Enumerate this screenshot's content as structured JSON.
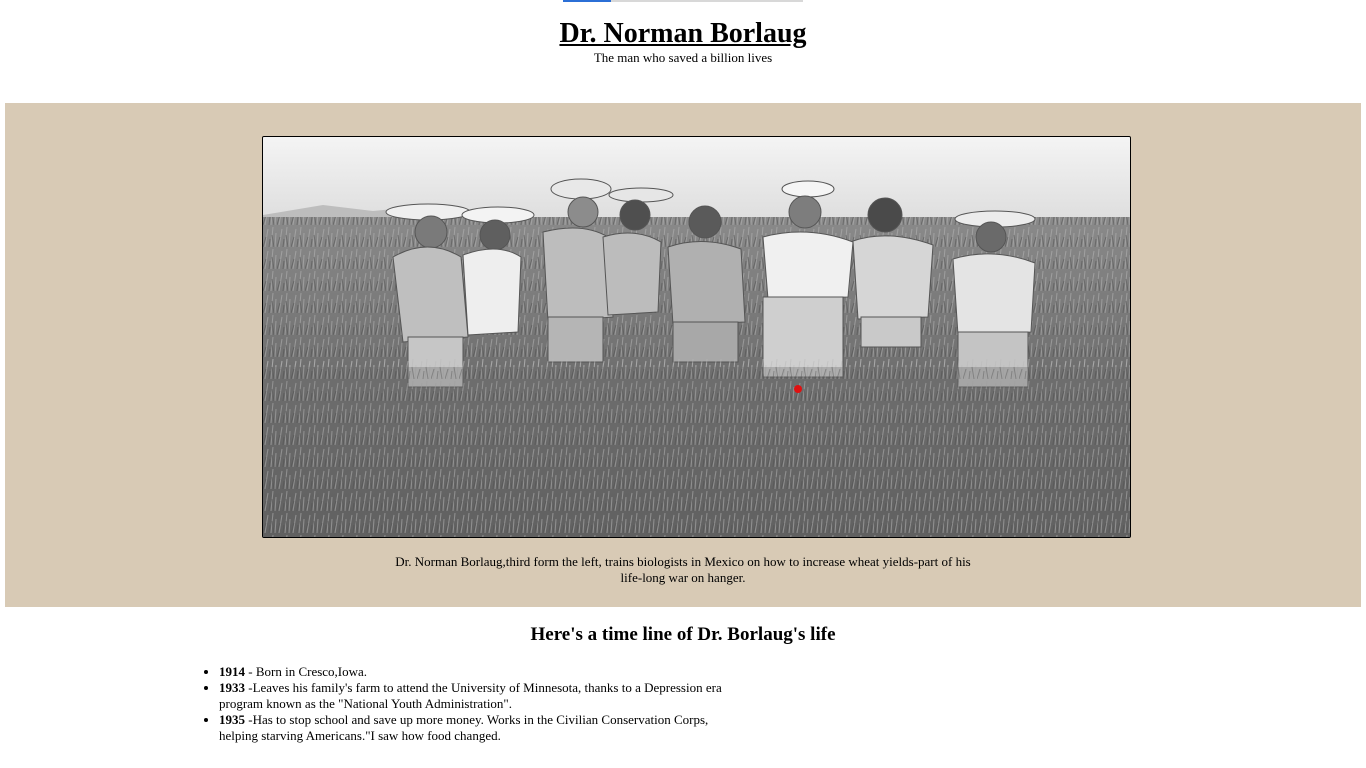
{
  "header": {
    "title": "Dr. Norman Borlaug",
    "subtitle": "The man who saved a billion lives"
  },
  "hero": {
    "image_alt": "Black and white photo of men standing in a wheat field",
    "caption": "Dr. Norman Borlaug,third form the left, trains biologists in Mexico on how to increase wheat yields-part of his life-long war on hanger."
  },
  "timeline": {
    "heading": "Here's a time line of Dr. Borlaug's life",
    "items": [
      {
        "year": "1914",
        "text": " - Born in Cresco,Iowa."
      },
      {
        "year": "1933",
        "text": " -Leaves his family's farm to attend the University of Minnesota, thanks to a Depression era program known as the \"National Youth Administration\"."
      },
      {
        "year": "1935",
        "text": " -Has to stop school and save up more money. Works in the Civilian Conservation Corps, helping starving Americans.\"I saw how food changed."
      }
    ]
  },
  "colors": {
    "hero_background": "#d8cab5",
    "accent_blue": "#2b6fd6"
  }
}
